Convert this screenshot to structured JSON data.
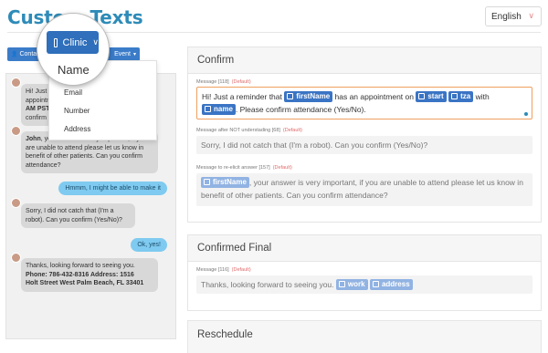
{
  "header": {
    "title": "Custom Texts",
    "language": "English"
  },
  "toolbar": {
    "contact_label": "Contac",
    "clinic_label": "Clinic",
    "event_label": "Event"
  },
  "dropdown": {
    "magnified_item": "Name",
    "items": [
      "Email",
      "Number",
      "Address"
    ]
  },
  "chat": {
    "msg1_lines": [
      "Hi! Just a remi",
      "appointmen",
      "AM PST wi",
      "confirm atte"
    ],
    "msg2_name": "John",
    "msg2_text": ", your answer is very important, if you are unable to attend please let us know in benefit of other patients. Can you confirm attendance?",
    "reply1": "Hmmm, I might be able to make it",
    "msg3": "Sorry, I did not catch that (I'm a robot). Can you confirm (Yes/No)?",
    "reply2": "Ok, yes!",
    "msg4_line1": "Thanks, looking forward to seeing you.",
    "msg4_line2": "Phone: 786-432-8316 Address: 1516",
    "msg4_line3": "Holt Street West Palm Beach, FL 33401"
  },
  "confirm": {
    "title": "Confirm",
    "message_label": "Message [118]",
    "default_label": "(Default)",
    "message_parts": [
      "Hi! Just a reminder that ",
      " has an appointment on ",
      " with",
      ". Please confirm attendance (Yes/No)."
    ],
    "tags": {
      "firstName": "firstName",
      "start": "start",
      "tza": "tza",
      "name": "name"
    },
    "not_understood_label": "Message after NOT understading [68]",
    "not_understood_text": "Sorry, I did not catch that (I'm a robot). Can you confirm (Yes/No)?",
    "reelicit_label": "Message to re-elicit answer [157]",
    "reelicit_text": ", your answer is very important, if you are unable to attend please let us know in benefit of other patients. Can you confirm attendance?"
  },
  "confirmed_final": {
    "title": "Confirmed Final",
    "message_label": "Message [116]",
    "default_label": "(Default)",
    "text": "Thanks, looking forward to seeing you.",
    "tags": {
      "work": "work",
      "address": "address"
    }
  },
  "reschedule": {
    "title": "Reschedule"
  }
}
